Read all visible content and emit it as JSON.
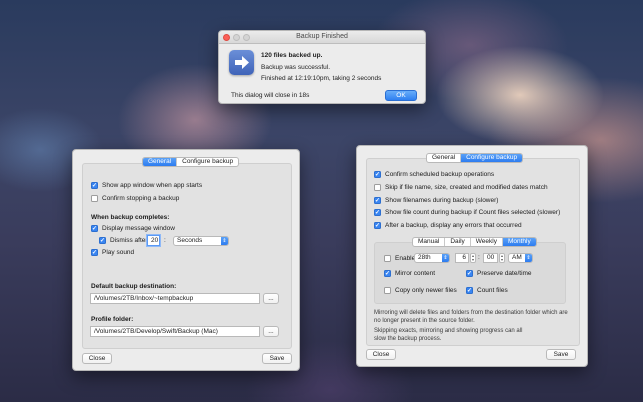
{
  "dialog": {
    "title": "Backup Finished",
    "heading": "120 files backed up.",
    "line1": "Backup was successful.",
    "line2": "Finished at 12:19:10pm, taking 2 seconds",
    "countdown": "This dialog will close in 18s",
    "ok_label": "OK"
  },
  "general": {
    "tabs": [
      "General",
      "Configure backup"
    ],
    "show_window": {
      "label": "Show app window when app starts",
      "checked": true
    },
    "confirm_stop": {
      "label": "Confirm stopping a backup",
      "checked": false
    },
    "completes_heading": "When backup completes:",
    "display_message": {
      "label": "Display message window",
      "checked": true
    },
    "dismiss": {
      "label": "Dismiss after",
      "checked": true,
      "value": "20",
      "colon": ":",
      "unit": "Seconds"
    },
    "play_sound": {
      "label": "Play sound",
      "checked": true
    },
    "dest_heading": "Default backup destination:",
    "dest_value": "/Volumes/2TB/Inbox/~tempbackup",
    "profile_heading": "Profile folder:",
    "profile_value": "/Volumes/2TB/Develop/Swift/Backup (Mac)",
    "ellipsis": "...",
    "close_label": "Close",
    "save_label": "Save"
  },
  "configure": {
    "tabs": [
      "General",
      "Configure backup"
    ],
    "options": [
      {
        "label": "Confirm scheduled backup operations",
        "checked": true
      },
      {
        "label": "Skip if file name, size, created and modified dates match",
        "checked": false
      },
      {
        "label": "Show filenames during backup (slower)",
        "checked": true
      },
      {
        "label": "Show file count during backup if Count files selected (slower)",
        "checked": true
      },
      {
        "label": "After a backup, display any errors that occurred",
        "checked": true
      }
    ],
    "schedule_tabs": [
      "Manual",
      "Daily",
      "Weekly",
      "Monthly"
    ],
    "enable": {
      "label": "Enable",
      "checked": false
    },
    "day": "28th",
    "hour": "6",
    "minute": "00",
    "ampm": "AM",
    "time_colon": ":",
    "mirror": {
      "label": "Mirror content",
      "checked": true
    },
    "preserve": {
      "label": "Preserve date/time",
      "checked": true
    },
    "copy_newer": {
      "label": "Copy only newer files",
      "checked": false
    },
    "count_files": {
      "label": "Count files",
      "checked": true
    },
    "note1": "Mirroring will delete files and folders from the destination folder which are no longer present in the source folder.",
    "note2": "Skipping exacts, mirroring and showing progress can all slow the backup process.",
    "close_label": "Close",
    "save_label": "Save"
  }
}
